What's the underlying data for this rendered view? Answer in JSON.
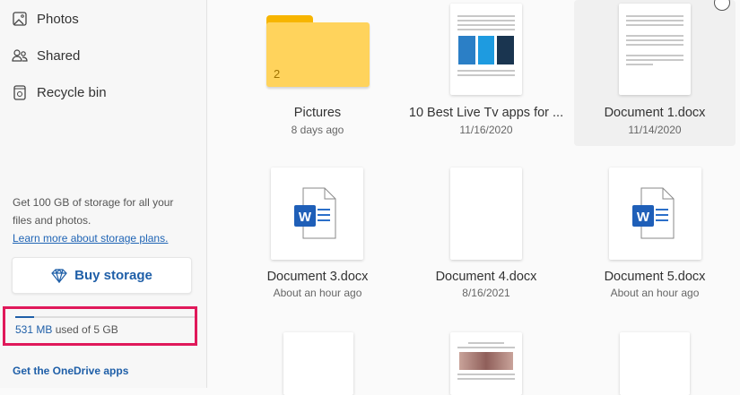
{
  "sidebar": {
    "items": [
      {
        "label": "Photos",
        "icon": "photo-icon"
      },
      {
        "label": "Shared",
        "icon": "people-icon"
      },
      {
        "label": "Recycle bin",
        "icon": "recycle-bin-icon"
      }
    ],
    "promo_text": "Get 100 GB of storage for all your files and photos.",
    "promo_link": "Learn more about storage plans.",
    "buy_label": "Buy storage",
    "quota": {
      "used": "531 MB",
      "rest": " used of 5 GB",
      "fraction": 0.104
    },
    "apps_link": "Get the OneDrive apps"
  },
  "files": [
    {
      "name": "Pictures",
      "date": "8 days ago",
      "type": "folder",
      "count": "2"
    },
    {
      "name": "10 Best Live Tv apps for ...",
      "date": "11/16/2020",
      "type": "doc-preview"
    },
    {
      "name": "Document 1.docx",
      "date": "11/14/2020",
      "type": "doc-preview",
      "selected": true
    },
    {
      "name": "Document 3.docx",
      "date": "About an hour ago",
      "type": "word"
    },
    {
      "name": "Document 4.docx",
      "date": "8/16/2021",
      "type": "blank"
    },
    {
      "name": "Document 5.docx",
      "date": "About an hour ago",
      "type": "word"
    }
  ],
  "colors": {
    "accent": "#1f5fa8",
    "highlight": "#e0195a",
    "folder": "#ffd35c"
  }
}
